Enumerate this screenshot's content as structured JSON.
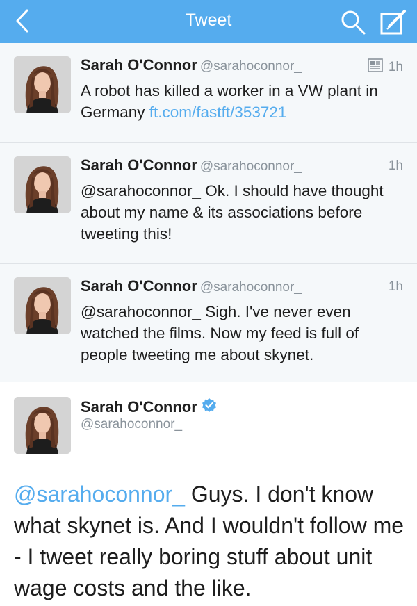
{
  "nav": {
    "title": "Tweet",
    "icons": [
      "back-chevron-icon",
      "search-icon",
      "compose-icon"
    ],
    "color": "#55acee"
  },
  "tweets": [
    {
      "name": "Sarah O'Connor",
      "handle": "@sarahoconnor_",
      "time": "1h",
      "has_media_icon": true,
      "text": "A robot has killed a worker in a VW plant in Germany ",
      "link": "ft.com/fastft/353721"
    },
    {
      "name": "Sarah O'Connor",
      "handle": "@sarahoconnor_",
      "time": "1h",
      "text": "@sarahoconnor_ Ok. I should have thought about my name & its associations before tweeting this!"
    },
    {
      "name": "Sarah O'Connor",
      "handle": "@sarahoconnor_",
      "time": "1h",
      "text": "@sarahoconnor_ Sigh. I've never even watched the films. Now my feed is full of people tweeting me about skynet."
    }
  ],
  "detail": {
    "name": "Sarah O'Connor",
    "handle": "@sarahoconnor_",
    "verified": true,
    "mention": "@sarahoconnor_",
    "text": " Guys. I don't know what skynet is. And I wouldn't follow me - I tweet really boring stuff about unit wage costs and the like."
  },
  "colors": {
    "link": "#55acee",
    "secondary_text": "#8a939b",
    "tweet_background": "#f5f8fa"
  }
}
